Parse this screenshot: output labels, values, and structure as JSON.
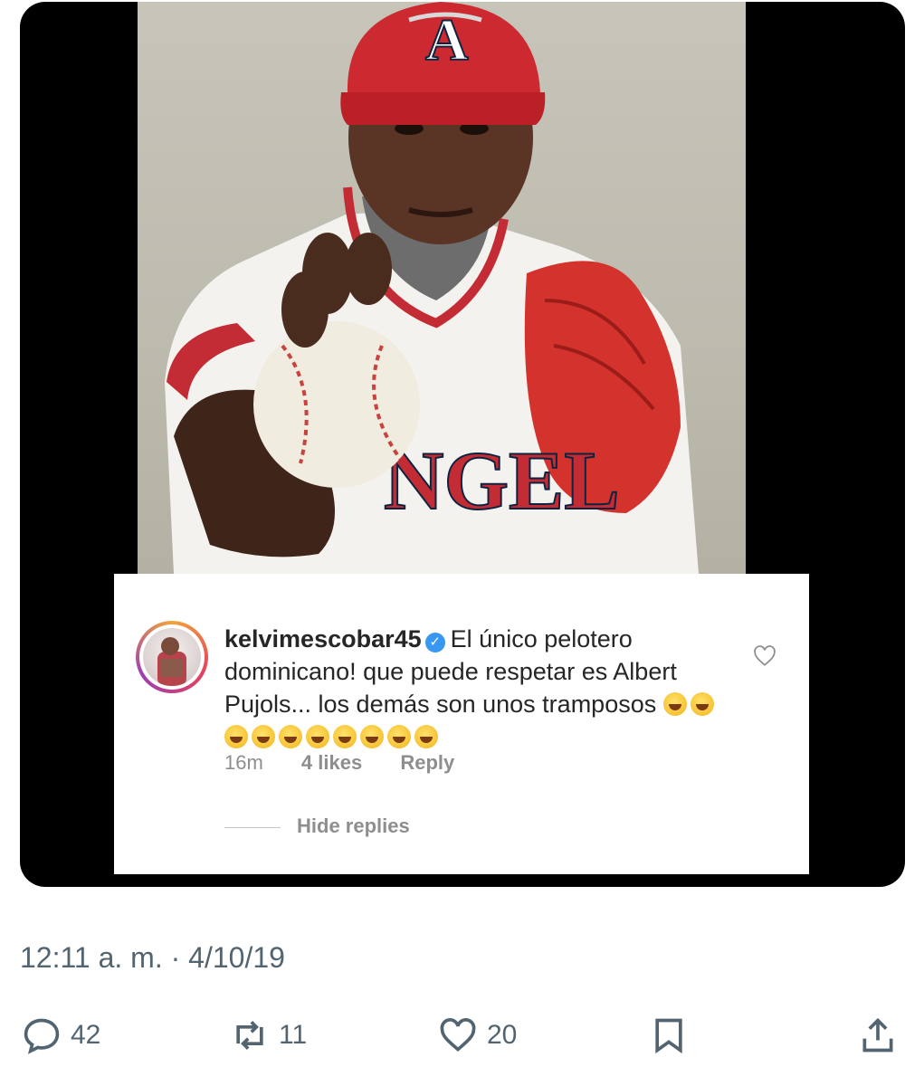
{
  "comment": {
    "username": "kelvimescobar45",
    "text_line1": "El único pelotero",
    "text_line2": "dominicano! que puede respetar es Albert",
    "text_line3": "Pujols... los demás son unos tramposos",
    "time": "16m",
    "likes": "4 likes",
    "reply_label": "Reply",
    "hide_replies_label": "Hide replies"
  },
  "jersey_text": "NGEL",
  "tweet": {
    "timestamp": "12:11 a. m. · 4/10/19",
    "replies": "42",
    "retweets": "11",
    "likes": "20"
  },
  "icons": [
    "reply-icon",
    "retweet-icon",
    "like-icon",
    "bookmark-icon",
    "share-icon",
    "verified-icon",
    "heart-icon"
  ],
  "colors": {
    "angels_red": "#ba1f2c",
    "instagram_verified": "#3897f0",
    "twitter_gray": "#536471"
  }
}
